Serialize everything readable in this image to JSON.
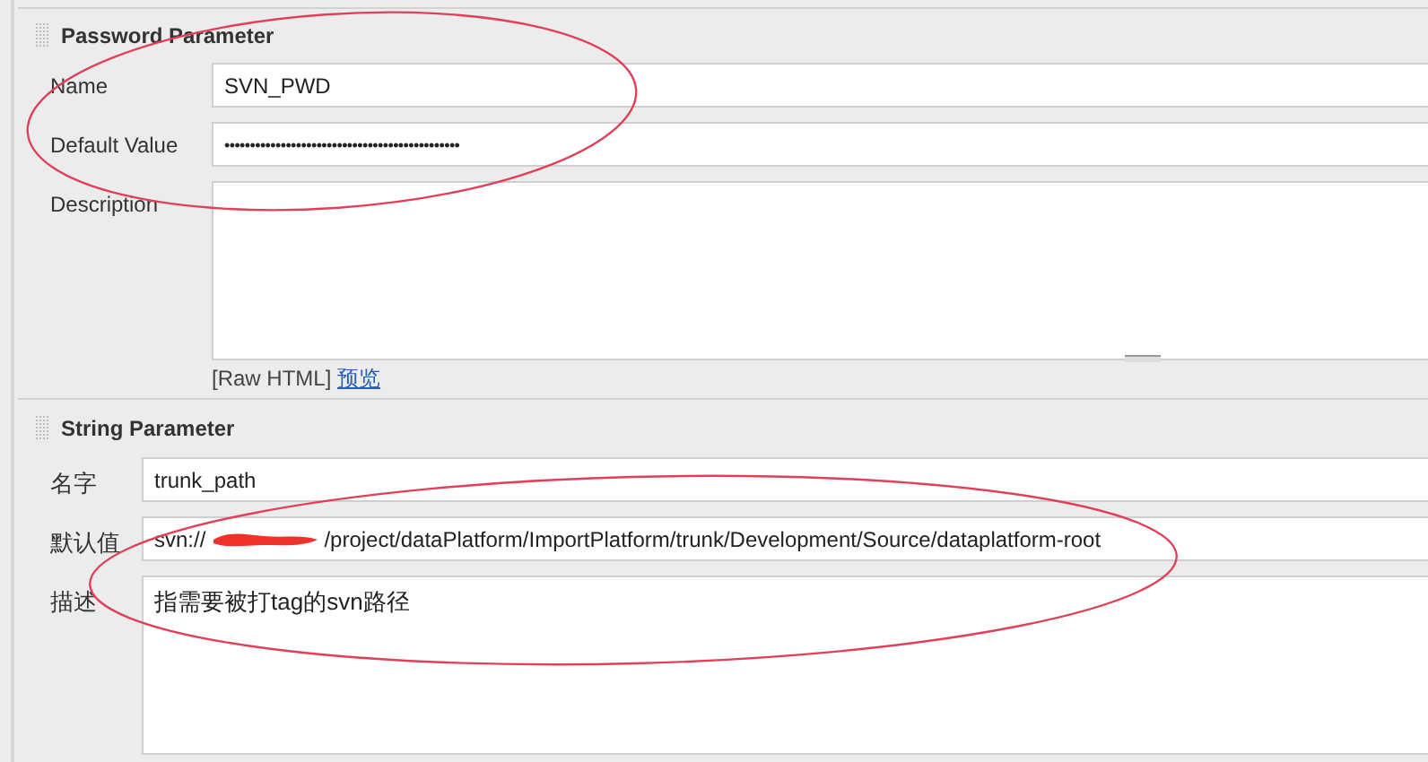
{
  "sections": [
    {
      "title": "Password Parameter",
      "fields": [
        {
          "kind": "text",
          "label": "Name",
          "value": "SVN_PWD"
        },
        {
          "kind": "password",
          "label": "Default Value",
          "value": "••••••••••••••••••••••••••••••••••••••••••••••"
        },
        {
          "kind": "textarea",
          "label": "Description",
          "footer": {
            "note": "[Raw HTML]",
            "link": "预览"
          }
        }
      ]
    },
    {
      "title": "String Parameter",
      "fields": [
        {
          "kind": "text",
          "label": "名字",
          "value": "trunk_path"
        },
        {
          "kind": "redacted",
          "label": "默认值",
          "value_start": "svn://",
          "value_end": "/project/dataPlatform/ImportPlatform/trunk/Development/Source/dataplatform-root"
        },
        {
          "kind": "textarea",
          "label": "描述",
          "value": "指需要被打tag的svn路径"
        }
      ]
    }
  ]
}
